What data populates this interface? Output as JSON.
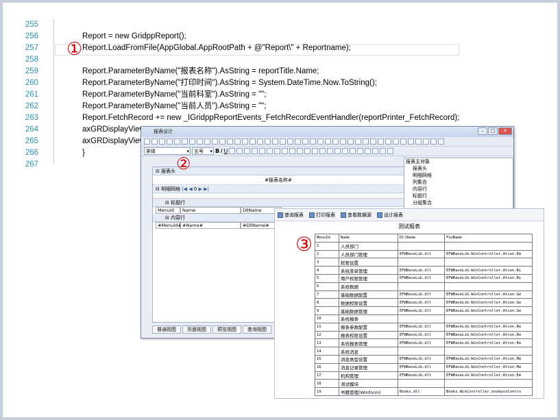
{
  "code": {
    "lines": [
      {
        "n": "255",
        "t": ""
      },
      {
        "n": "256",
        "t": "Report = new GridppReport();"
      },
      {
        "n": "257",
        "t": "Report.LoadFromFile(AppGlobal.AppRootPath + @\"Report\\\" + Reportname);"
      },
      {
        "n": "258",
        "t": ""
      },
      {
        "n": "259",
        "t": "Report.ParameterByName(\"报表名称\").AsString = reportTitle.Name;"
      },
      {
        "n": "260",
        "t": "Report.ParameterByName(\"打印时间\").AsString = System.DateTime.Now.ToString();"
      },
      {
        "n": "261",
        "t": "Report.ParameterByName(\"当前科室\").AsString = \"\";"
      },
      {
        "n": "262",
        "t": "Report.ParameterByName(\"当前人员\").AsString = \"\";"
      },
      {
        "n": "263",
        "t": "Report.FetchRecord += new _IGridppReportEvents_FetchRecordEventHandler(reportPrinter_FetchRecord);"
      },
      {
        "n": "264",
        "t": "axGRDisplayView"
      },
      {
        "n": "265",
        "t": "axGRDisplayView"
      },
      {
        "n": "266",
        "t": "}"
      },
      {
        "n": "267",
        "t": ""
      }
    ]
  },
  "markers": {
    "m1": "①",
    "m2": "②",
    "m3": "③"
  },
  "designer": {
    "title": "报表设计",
    "font": "宋体",
    "size": "五号",
    "band_header": "报表头",
    "param_title": "#报表名称#",
    "grid_label": "明细网格",
    "nav_num": "0",
    "col_head_band": "标题行",
    "content_band": "内容行",
    "head_cells": [
      "MenuId",
      "Name",
      "DllName"
    ],
    "body_cells": [
      "#MenuId#",
      "#Name#",
      "#DllName#"
    ],
    "tree": [
      "报表主对象",
      "报表头",
      "明细网格",
      "列集合",
      "内容行",
      "标题行",
      "分组集合"
    ],
    "tabs": [
      "普通视图",
      "页面视图",
      "预览视图",
      "查询视图"
    ]
  },
  "preview": {
    "buttons": [
      "查询报表",
      "打印报表",
      "查看数据源",
      "设计报表"
    ],
    "title": "测试报表",
    "headers": [
      "MenuId",
      "Name",
      "DllName",
      "FunName"
    ],
    "rows": [
      [
        "1",
        "人员部门",
        "",
        ""
      ],
      [
        "2",
        "人员部门管理",
        "EFWBaseLib.dll",
        "EFWBaseLib.WinController.Ation.Em"
      ],
      [
        "3",
        "权限设置",
        "",
        ""
      ],
      [
        "4",
        "系统菜单管理",
        "EFWBaseLib.dll",
        "EFWBaseLib.WinController.Ation.Ri"
      ],
      [
        "5",
        "用户权限管理",
        "EFWBaseLib.dll",
        "EFWBaseLib.WinController.Ation.Ri"
      ],
      [
        "6",
        "系统数据",
        "",
        ""
      ],
      [
        "7",
        "基础数据配置",
        "EFWBaseLib.dll",
        "EFWBaseLib.WinController.Ation.Ge"
      ],
      [
        "8",
        "数据权限设置",
        "EFWBaseLib.dll",
        "EFWBaseLib.WinController.Ation.Ge"
      ],
      [
        "9",
        "基础数据管理",
        "EFWBaseLib.dll",
        "EFWBaseLib.WinController.Ation.Ge"
      ],
      [
        "10",
        "系统报表",
        "",
        ""
      ],
      [
        "11",
        "报表参数配置",
        "EFWBaseLib.dll",
        "EFWBaseLib.WinController.Ation.Re"
      ],
      [
        "12",
        "报表权限设置",
        "EFWBaseLib.dll",
        "EFWBaseLib.WinController.Ation.Re"
      ],
      [
        "13",
        "系统报表管理",
        "EFWBaseLib.dll",
        "EFWBaseLib.WinController.Ation.Re"
      ],
      [
        "14",
        "系统消息",
        "",
        ""
      ],
      [
        "15",
        "消息类型设置",
        "EFWBaseLib.dll",
        "EFWBaseLib.WinController.Ation.Me"
      ],
      [
        "16",
        "消息记录管理",
        "EFWBaseLib.dll",
        "EFWBaseLib.WinController.Ation.Me"
      ],
      [
        "17",
        "机构管理",
        "EFWBaseLib.dll",
        "EFWBaseLib.WinController.Ation.Em"
      ],
      [
        "18",
        "测试模块",
        "",
        ""
      ],
      [
        "19",
        "书籍管理(Winform)",
        "Books.dll",
        "Books.WinController.bookwinContro"
      ]
    ]
  }
}
